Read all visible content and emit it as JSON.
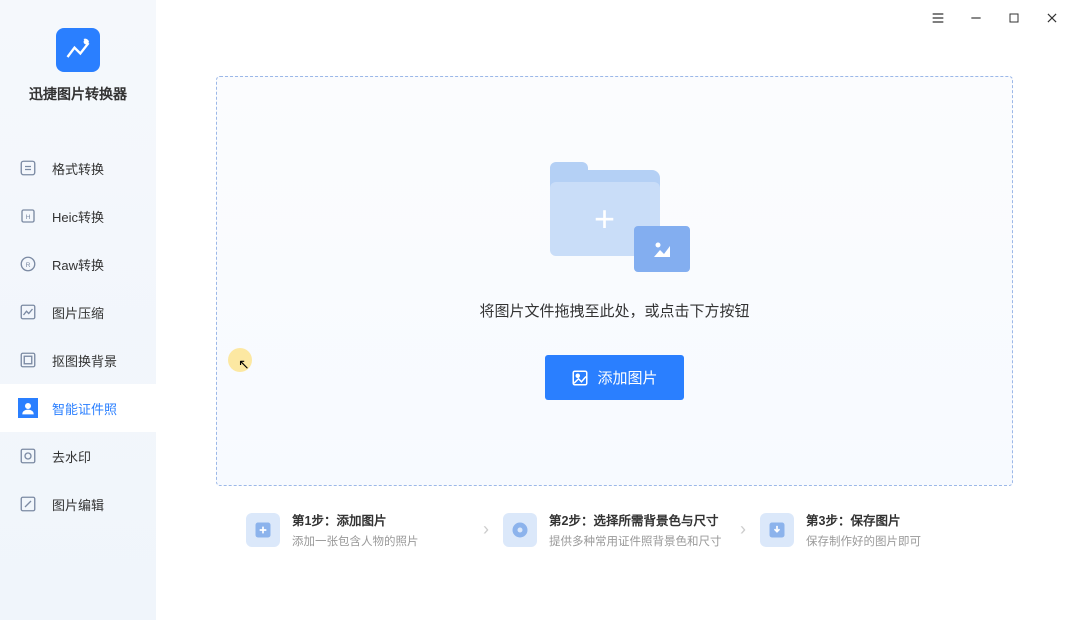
{
  "app": {
    "title": "迅捷图片转换器"
  },
  "nav": {
    "items": [
      {
        "label": "格式转换"
      },
      {
        "label": "Heic转换"
      },
      {
        "label": "Raw转换"
      },
      {
        "label": "图片压缩"
      },
      {
        "label": "抠图换背景"
      },
      {
        "label": "智能证件照"
      },
      {
        "label": "去水印"
      },
      {
        "label": "图片编辑"
      }
    ]
  },
  "dropzone": {
    "hint": "将图片文件拖拽至此处，或点击下方按钮",
    "button": "添加图片"
  },
  "steps": [
    {
      "title": "第1步：添加图片",
      "desc": "添加一张包含人物的照片"
    },
    {
      "title": "第2步：选择所需背景色与尺寸",
      "desc": "提供多种常用证件照背景色和尺寸"
    },
    {
      "title": "第3步：保存图片",
      "desc": "保存制作好的图片即可"
    }
  ]
}
